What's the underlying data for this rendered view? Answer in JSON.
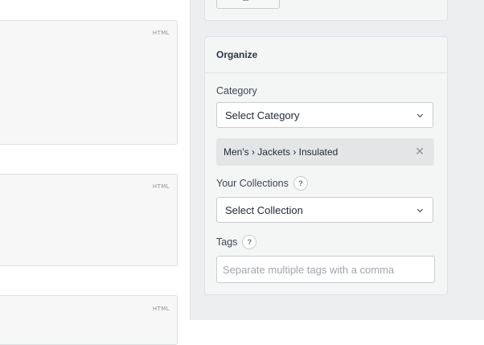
{
  "editors": {
    "tag": "HTML"
  },
  "organize": {
    "title": "Organize",
    "category": {
      "label": "Category",
      "selected": "Select Category",
      "chip": "Men's › Jackets › Insulated",
      "remove_glyph": "✕"
    },
    "collections": {
      "label": "Your Collections",
      "help": "?",
      "selected": "Select Collection"
    },
    "tags": {
      "label": "Tags",
      "help": "?",
      "placeholder": "Separate multiple tags with a comma"
    }
  }
}
